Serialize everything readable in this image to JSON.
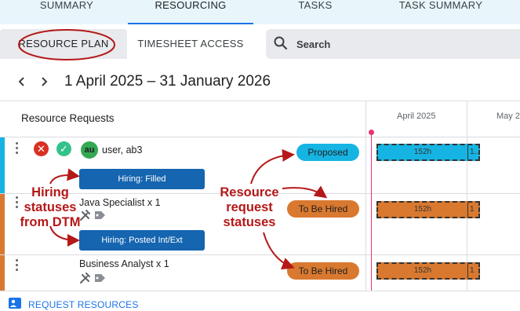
{
  "top_tabs": [
    {
      "label": "SUMMARY"
    },
    {
      "label": "RESOURCING"
    },
    {
      "label": "TASKS"
    },
    {
      "label": "TASK SUMMARY"
    }
  ],
  "sub_tabs": {
    "resource_plan": "RESOURCE PLAN",
    "timesheet_access": "TIMESHEET ACCESS"
  },
  "search": {
    "placeholder": "Search"
  },
  "date_range": "1 April 2025 – 31 January 2026",
  "grid": {
    "column_header": "Resource Requests",
    "months": [
      "April 2025",
      "May 2"
    ]
  },
  "rows": [
    {
      "avatar_initials": "au",
      "name": "user, ab3",
      "hiring_status": "Hiring: Filled",
      "request_status": "Proposed",
      "bar_value": "152h",
      "bar_overflow": "1..",
      "accent_color": "#16b4e2"
    },
    {
      "name": "Java Specialist x 1",
      "hiring_status": "Hiring: Posted Int/Ext",
      "request_status": "To Be Hired",
      "bar_value": "152h",
      "bar_overflow": "1",
      "accent_color": "#d9792f"
    },
    {
      "name": "Business Analyst x 1",
      "request_status": "To Be Hired",
      "bar_value": "152h",
      "bar_overflow": "1",
      "accent_color": "#d9792f"
    }
  ],
  "annotations": {
    "hiring": "Hiring statuses from DTM",
    "resource": "Resource request statuses"
  },
  "footer": {
    "request_resources": "REQUEST RESOURCES"
  },
  "colors": {
    "proposed": "#16b4e2",
    "to_be_hired": "#d9792f",
    "hiring_button": "#1565b0",
    "today_line": "#e8336f",
    "annotation": "#b51818"
  }
}
